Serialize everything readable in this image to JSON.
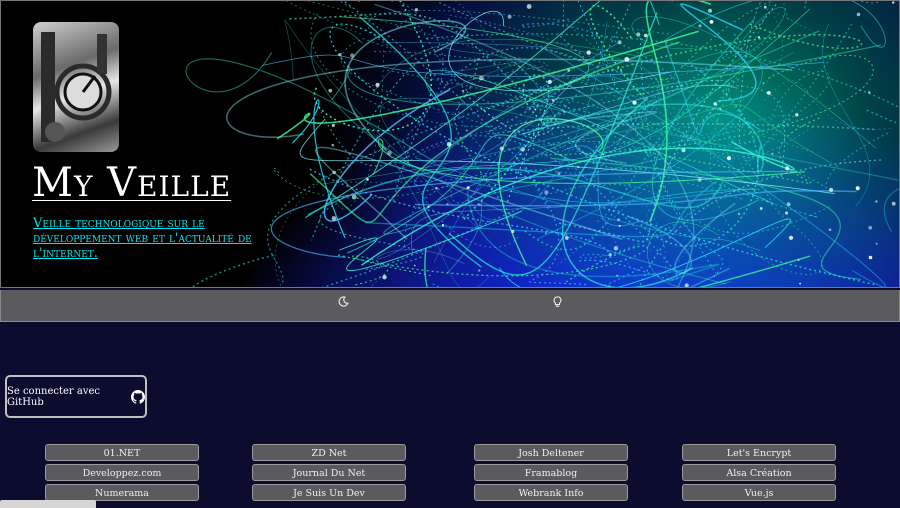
{
  "header": {
    "title": "My Veille",
    "tagline": "Veille technologique sur le développement web et l'actualité de l'internet."
  },
  "toolbar": {
    "dark_mode_icon": "moon-icon",
    "light_mode_icon": "lightbulb-icon"
  },
  "auth": {
    "github_label": "Se connecter avec GitHub",
    "github_icon": "github-icon"
  },
  "links": {
    "col1": [
      "01.NET",
      "Developpez.com",
      "Numerama"
    ],
    "col2": [
      "ZD Net",
      "Journal Du Net",
      "Je Suis Un Dev"
    ],
    "col3": [
      "Josh Deltener",
      "Framablog",
      "Webrank Info"
    ],
    "col4": [
      "Let's Encrypt",
      "Alsa Création",
      "Vue.js"
    ]
  },
  "colors": {
    "background": "#0b0c2e",
    "toolbar": "#5b5b5f",
    "tagline": "#00e6f0"
  }
}
